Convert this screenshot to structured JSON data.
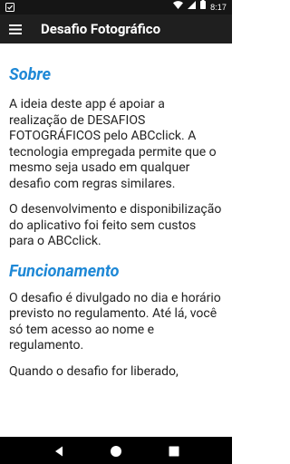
{
  "status_bar": {
    "time": "8:17"
  },
  "app_bar": {
    "title": "Desafio Fotográfico",
    "menu_icon": "hamburger-menu-icon"
  },
  "content": {
    "sections": [
      {
        "title": "Sobre",
        "paragraphs": [
          "A ideia deste app é apoiar a realização de DESAFIOS FOTOGRÁFICOS pelo ABCclick. A tecnologia empregada permite que o mesmo seja usado em qualquer desafio com regras similares.",
          "O desenvolvimento e disponibilização do aplicativo foi feito sem custos para o ABCclick."
        ]
      },
      {
        "title": "Funcionamento",
        "paragraphs": [
          "O desafio é divulgado no dia e horário previsto no regulamento. Até lá, você só tem acesso ao nome e regulamento.",
          "Quando o desafio for liberado,"
        ]
      }
    ]
  },
  "colors": {
    "accent": "#1e88d6",
    "app_bar": "#1f1f1f",
    "status_bar": "#151515"
  }
}
